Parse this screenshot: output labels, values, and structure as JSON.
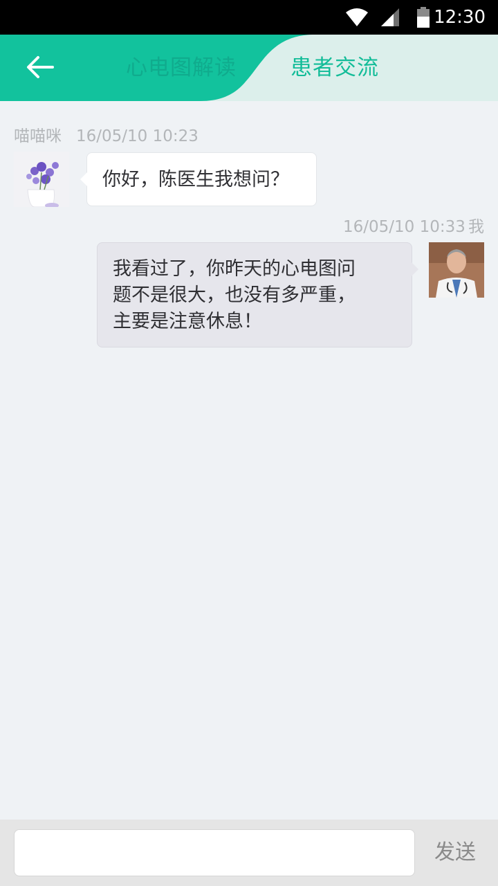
{
  "status_bar": {
    "time": "12:30",
    "icons": [
      "wifi-icon",
      "signal-icon",
      "battery-icon"
    ]
  },
  "header": {
    "back_icon": "arrow-left-icon",
    "tabs": [
      {
        "label": "心电图解读",
        "active": false
      },
      {
        "label": "患者交流",
        "active": true
      }
    ],
    "colors": {
      "accent": "#12c29d",
      "inactive_bg": "#dcefeb"
    }
  },
  "messages": [
    {
      "side": "left",
      "sender": "喵喵咪",
      "time": "16/05/10 10:23",
      "avatar": "flower-vase-avatar",
      "lines": [
        "你好，陈医生我想问？"
      ]
    },
    {
      "side": "right",
      "sender": "我",
      "time": "16/05/10 10:33",
      "avatar": "doctor-avatar",
      "lines": [
        "我看过了，你昨天的心电图问",
        "题不是很大，也没有多严重，",
        "主要是注意休息！"
      ]
    }
  ],
  "composer": {
    "input_value": "",
    "send_label": "发送"
  }
}
